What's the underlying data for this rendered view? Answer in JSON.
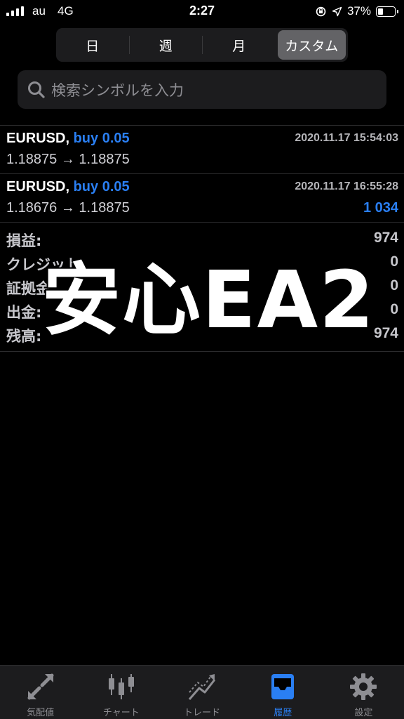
{
  "status_bar": {
    "carrier": "au",
    "network": "4G",
    "time": "2:27",
    "battery_percent": "37%",
    "battery_level": 0.37
  },
  "segments": [
    {
      "label": "日",
      "active": false
    },
    {
      "label": "週",
      "active": false
    },
    {
      "label": "月",
      "active": false
    },
    {
      "label": "カスタム",
      "active": true
    }
  ],
  "search": {
    "placeholder": "検索シンボルを入力"
  },
  "deals": [
    {
      "symbol": "EURUSD,",
      "type": "buy 0.05",
      "datetime": "2020.11.17 15:54:03",
      "prices": "1.18875 → 1.18875",
      "profit": ""
    },
    {
      "symbol": "EURUSD,",
      "type": "buy 0.05",
      "datetime": "2020.11.17 16:55:28",
      "prices": "1.18676 → 1.18875",
      "profit": "1 034"
    }
  ],
  "summary": [
    {
      "label": "損益:",
      "value": "974"
    },
    {
      "label": "クレジット:",
      "value": "0"
    },
    {
      "label": "証拠金:",
      "value": "0"
    },
    {
      "label": "出金:",
      "value": "0"
    },
    {
      "label": "残高:",
      "value": "974"
    }
  ],
  "overlay_text": "安心EA2",
  "tabs": [
    {
      "label": "気配値",
      "icon": "quotes-arrows-icon",
      "active": false
    },
    {
      "label": "チャート",
      "icon": "candlestick-chart-icon",
      "active": false
    },
    {
      "label": "トレード",
      "icon": "trade-chart-icon",
      "active": false
    },
    {
      "label": "履歴",
      "icon": "history-inbox-icon",
      "active": true
    },
    {
      "label": "設定",
      "icon": "settings-gear-icon",
      "active": false
    }
  ],
  "colors": {
    "accent": "#2a7ff3",
    "background": "#000000",
    "panel": "#1c1c1e",
    "muted": "#8e8e93"
  }
}
